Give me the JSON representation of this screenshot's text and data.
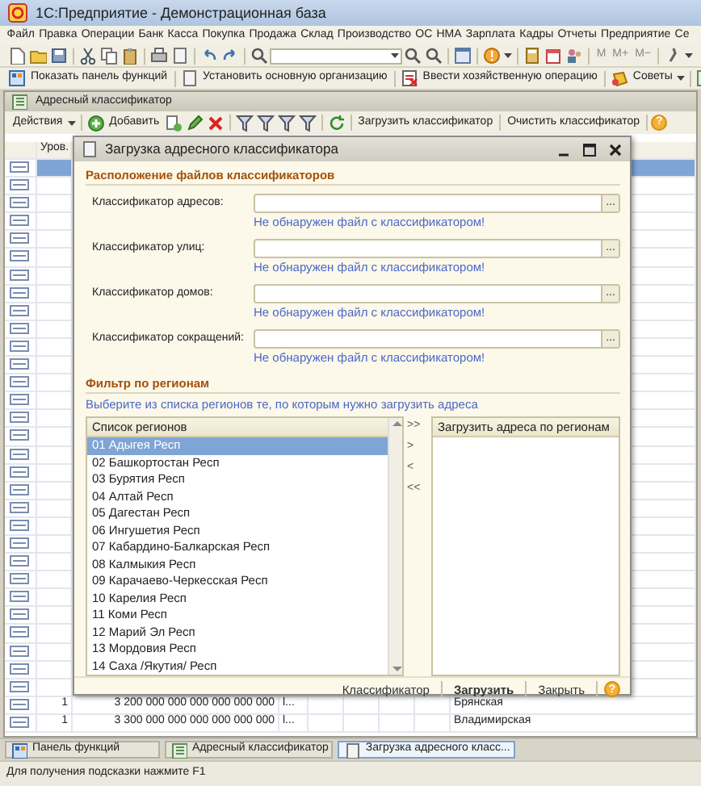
{
  "window": {
    "title": "1С:Предприятие - Демонстрационная база"
  },
  "menu": [
    "Файл",
    "Правка",
    "Операции",
    "Банк",
    "Касса",
    "Покупка",
    "Продажа",
    "Склад",
    "Производство",
    "ОС",
    "НМА",
    "Зарплата",
    "Кадры",
    "Отчеты",
    "Предприятие",
    "Се"
  ],
  "toolbar": {
    "memory_buttons": [
      "M",
      "M+",
      "M−"
    ]
  },
  "panel_toolbar": [
    "Показать панель функций",
    "Установить основную организацию",
    "Ввести хозяйственную операцию",
    "Советы"
  ],
  "subwindow": {
    "title": "Адресный классификатор",
    "actions_menu": "Действия",
    "add_button": "Добавить",
    "buttons": [
      "Загрузить классификатор",
      "Очистить классификатор"
    ],
    "help": "?"
  },
  "table": {
    "columns": [
      "Уров."
    ],
    "rows": [
      {
        "selected": true
      },
      {
        "selected": false
      },
      {
        "selected": false
      },
      {
        "selected": false
      },
      {
        "selected": false
      },
      {
        "selected": false
      },
      {
        "selected": false
      },
      {
        "selected": false
      },
      {
        "selected": false
      },
      {
        "selected": false
      },
      {
        "selected": false
      },
      {
        "selected": false
      },
      {
        "selected": false
      },
      {
        "selected": false
      },
      {
        "selected": false
      },
      {
        "selected": false
      },
      {
        "selected": false
      },
      {
        "selected": false
      },
      {
        "selected": false
      },
      {
        "selected": false
      },
      {
        "selected": false
      },
      {
        "selected": false
      },
      {
        "selected": false
      },
      {
        "selected": false
      },
      {
        "selected": false
      },
      {
        "selected": false
      },
      {
        "selected": false
      },
      {
        "selected": false
      },
      {
        "selected": false
      },
      {
        "selected": false
      },
      {
        "selected": false,
        "level": "1",
        "code": "3 200 000 000 000 000 000 000",
        "column_3": "l...",
        "name": "Брянская"
      },
      {
        "selected": false,
        "level": "1",
        "code": "3 300 000 000 000 000 000 000",
        "column_3": "l...",
        "name": "Владимирская"
      }
    ]
  },
  "dialog": {
    "title": "Загрузка адресного классификатора",
    "files_heading": "Расположение файлов классификаторов",
    "files": [
      {
        "label": "Классификатор адресов:",
        "browse": "...",
        "warning": "Не обнаружен файл с классификатором!"
      },
      {
        "label": "Классификатор улиц:",
        "browse": "...",
        "warning": "Не обнаружен файл с классификатором!"
      },
      {
        "label": "Классификатор домов:",
        "browse": "...",
        "warning": "Не обнаружен файл с классификатором!"
      },
      {
        "label": "Классификатор сокращений:",
        "browse": "...",
        "warning": "Не обнаружен файл с классификатором!"
      }
    ],
    "filter_heading": "Фильтр по регионам",
    "filter_hint": "Выберите из списка регионов те, по которым нужно загрузить адреса",
    "regions": {
      "header": "Список регионов",
      "items": [
        {
          "label": "01 Адыгея Респ",
          "selected": true
        },
        {
          "label": "02 Башкортостан Респ",
          "selected": false
        },
        {
          "label": "03 Бурятия Респ",
          "selected": false
        },
        {
          "label": "04 Алтай Респ",
          "selected": false
        },
        {
          "label": "05 Дагестан Респ",
          "selected": false
        },
        {
          "label": "06 Ингушетия Респ",
          "selected": false
        },
        {
          "label": "07 Кабардино-Балкарская Респ",
          "selected": false
        },
        {
          "label": "08 Калмыкия Респ",
          "selected": false
        },
        {
          "label": "09 Карачаево-Черкесская Респ",
          "selected": false
        },
        {
          "label": "10 Карелия Респ",
          "selected": false
        },
        {
          "label": "11 Коми Респ",
          "selected": false
        },
        {
          "label": "12 Марий Эл Респ",
          "selected": false
        },
        {
          "label": "13 Мордовия Респ",
          "selected": false
        },
        {
          "label": "14 Саха /Якутия/ Респ",
          "selected": false
        }
      ]
    },
    "move_buttons": [
      ">>",
      ">",
      "<",
      "<<"
    ],
    "chosen": {
      "header": "Загрузить адреса по регионам"
    },
    "footer_buttons": [
      {
        "label": "Классификатор",
        "default": false
      },
      {
        "label": "Загрузить",
        "default": true
      },
      {
        "label": "Закрыть",
        "default": false
      }
    ],
    "help": "?"
  },
  "taskbar": [
    {
      "label": "Панель функций",
      "selected": false
    },
    {
      "label": "Адресный классификатор",
      "selected": false
    },
    {
      "label": "Загрузка адресного класс...",
      "selected": true
    }
  ],
  "status_bar": "Для получения подсказки нажмите F1"
}
